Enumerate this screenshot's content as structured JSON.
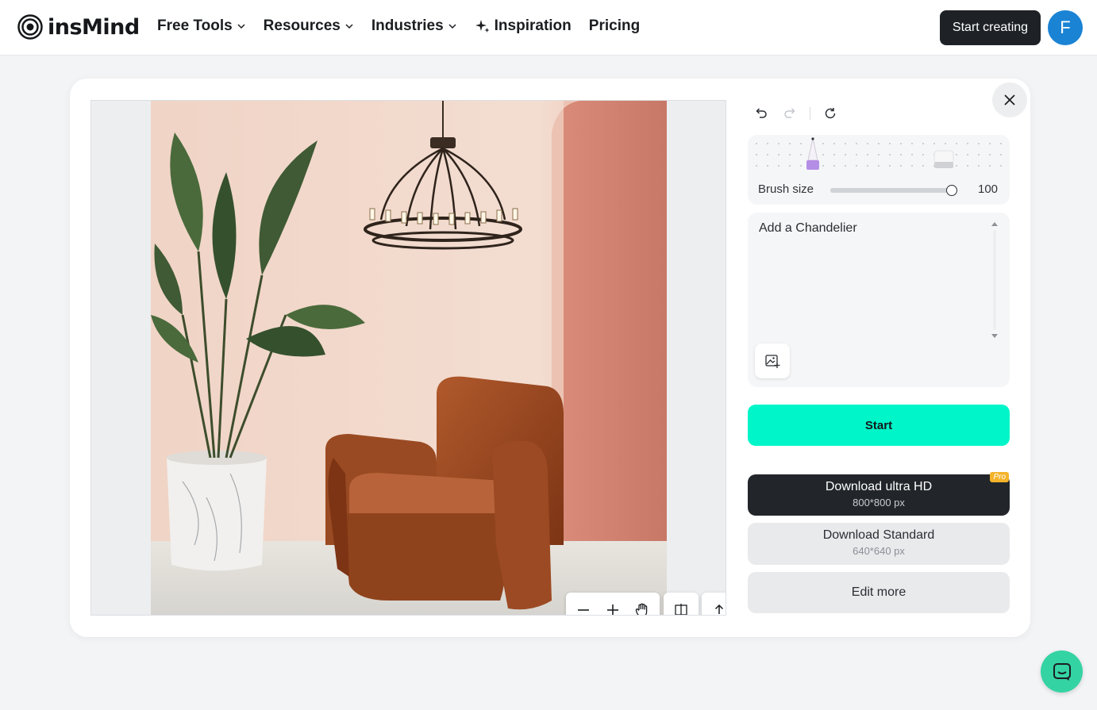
{
  "header": {
    "logo_text": "insMind",
    "nav": [
      {
        "label": "Free Tools",
        "has_dropdown": true
      },
      {
        "label": "Resources",
        "has_dropdown": true
      },
      {
        "label": "Industries",
        "has_dropdown": true
      },
      {
        "label": "Inspiration",
        "icon": "sparkle-icon"
      },
      {
        "label": "Pricing"
      }
    ],
    "cta_label": "Start creating",
    "avatar_initial": "F"
  },
  "editor": {
    "brush": {
      "label": "Brush size",
      "value": "100",
      "level": 1.0
    },
    "prompt": {
      "text": "Add a Chandelier"
    },
    "start_label": "Start",
    "download_hd": {
      "label": "Download ultra HD",
      "size": "800*800 px",
      "badge": "Pro"
    },
    "download_standard": {
      "label": "Download Standard",
      "size": "640*640 px"
    },
    "edit_more_label": "Edit more"
  },
  "colors": {
    "accent": "#00f5c8",
    "dark": "#22262b",
    "avatar": "#1a83d4",
    "pro_badge": "#f4b32a",
    "chat": "#34d3a4"
  }
}
